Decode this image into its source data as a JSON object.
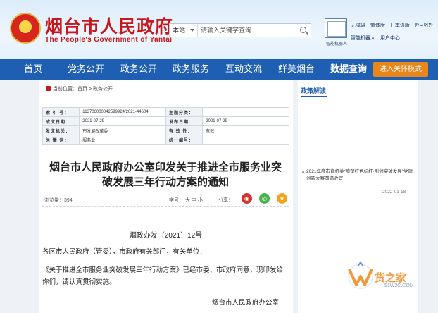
{
  "header": {
    "site_title": "烟台市人民政府",
    "site_subtitle": "The People's Government of Yantai",
    "search_scope": "本站",
    "search_placeholder": "请输入关键字查询",
    "links_row1": [
      "无障碍",
      "繁体版",
      "日本语版",
      "한국어판"
    ],
    "links_row2": [
      "智能机器人",
      "用户中心"
    ],
    "badge_caption": "智能机器人"
  },
  "nav": {
    "items": [
      "首页",
      "党务公开",
      "政务公开",
      "政务服务",
      "互动交流",
      "鲜美烟台",
      "数据查询"
    ],
    "active": "数据查询",
    "care_mode_button": "进入关怀模式"
  },
  "breadcrumb": "当前位置：首页 > 政务公开",
  "meta": {
    "rows": [
      [
        "索 引 号：",
        "113706000042599924/2021-44604",
        "主题分类：",
        ""
      ],
      [
        "成文日期：",
        "2021-07-29",
        "发布日期：",
        "2021-07-29"
      ],
      [
        "发文机关：",
        "市发展改革委",
        "有 效 性：",
        "有效"
      ],
      [
        "关 键 词：",
        "服务业",
        "统一编号：",
        ""
      ]
    ]
  },
  "article": {
    "title": "烟台市人民政府办公室印发关于推进全市服务业突破发展三年行动方案的通知",
    "views": "浏览量：394",
    "font_size": "字号： 大 中 小",
    "share": "分享：",
    "doc_number": "烟政办发〔2021〕12号",
    "para1": "各区市人民政府（管委），市政府有关部门，有关单位：",
    "para2": "《关于推进全市服务业突破发展三年行动方案》已经市委、市政府同意，现印发给你们，请认真贯彻实施。",
    "signature": "烟台市人民政府办公室"
  },
  "sidebar": {
    "title": "政策解读",
    "news": [
      {
        "text": "2021年度市直机关“喷塑红色标杆·引领突破发展”党建创新大赛圆满收官",
        "date": "2022-01-18"
      }
    ]
  },
  "watermark": {
    "name": "货之家",
    "url": "51W2C.COM"
  },
  "colors": {
    "brand_red": "#c8161d",
    "nav_blue": "#1e5fb4",
    "care_orange": "#e8861a"
  }
}
